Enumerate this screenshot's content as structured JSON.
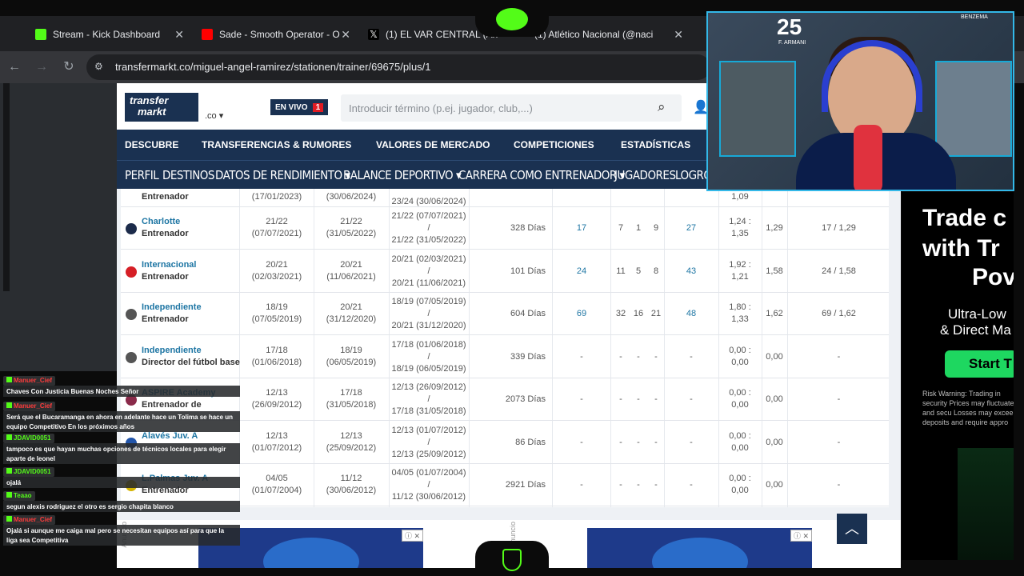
{
  "browser": {
    "tabs": [
      {
        "label": "Stream - Kick Dashboard",
        "color": "#53fc18"
      },
      {
        "label": "Sade - Smooth Operator - O",
        "color": "#ff0000"
      },
      {
        "label": "(1) EL VAR CENTRAL (An",
        "color": "#000000"
      },
      {
        "label": "(1) Atlético Nacional (@naci",
        "color": "#000000"
      }
    ],
    "url": "transfermarkt.co/miguel-angel-ramirez/stationen/trainer/69675/plus/1"
  },
  "site": {
    "logo_line1": "transfer",
    "logo_line2": "markt",
    "domain_suffix": ".co ▾",
    "live_label": "EN VIVO",
    "live_count": "1",
    "search_placeholder": "Introducir término (p.ej. jugador, club,...)"
  },
  "main_nav": [
    "DESCUBRE",
    "TRANSFERENCIAS & RUMORES",
    "VALORES DE MERCADO",
    "COMPETICIONES",
    "ESTADÍSTICAS"
  ],
  "sub_nav": [
    "PERFIL",
    "DESTINOS",
    "DATOS DE RENDIMIENTO ▾",
    "BALANCE DEPORTIVO ▾",
    "CARRERA COMO ENTRENADOR ▾",
    "JUGADORES",
    "LOGRO"
  ],
  "table": {
    "partial_row": {
      "role": "Entrenador",
      "from": "(17/01/2023)",
      "to": "(30/06/2024)",
      "period": "23/24 (30/06/2024)",
      "ppg": "1,09"
    },
    "rows": [
      {
        "club": "Charlotte",
        "role": "Entrenador",
        "from_season": "21/22",
        "from_date": "(07/07/2021)",
        "to_season": "21/22",
        "to_date": "(31/05/2022)",
        "period_start": "21/22 (07/07/2021)",
        "period_sep": "/",
        "period_end": "21/22 (31/05/2022)",
        "days": "328 Días",
        "matches": "17",
        "w": "7",
        "d": "1",
        "l": "9",
        "players": "27",
        "ppg_a": "1,24 :",
        "ppg_b": "1,35",
        "ppg": "1,29",
        "last": "17 / 1,29",
        "icon_color": "#1c2b4a"
      },
      {
        "club": "Internacional",
        "role": "Entrenador",
        "from_season": "20/21",
        "from_date": "(02/03/2021)",
        "to_season": "20/21",
        "to_date": "(11/06/2021)",
        "period_start": "20/21 (02/03/2021)",
        "period_sep": "/",
        "period_end": "20/21 (11/06/2021)",
        "days": "101 Días",
        "matches": "24",
        "w": "11",
        "d": "5",
        "l": "8",
        "players": "43",
        "ppg_a": "1,92 :",
        "ppg_b": "1,21",
        "ppg": "1,58",
        "last": "24 / 1,58",
        "icon_color": "#d61f26"
      },
      {
        "club": "Independiente",
        "role": "Entrenador",
        "from_season": "18/19",
        "from_date": "(07/05/2019)",
        "to_season": "20/21",
        "to_date": "(31/12/2020)",
        "period_start": "18/19 (07/05/2019)",
        "period_sep": "/",
        "period_end": "20/21 (31/12/2020)",
        "days": "604 Días",
        "matches": "69",
        "w": "32",
        "d": "16",
        "l": "21",
        "players": "48",
        "ppg_a": "1,80 :",
        "ppg_b": "1,33",
        "ppg": "1,62",
        "last": "69 / 1,62",
        "icon_color": "#555555"
      },
      {
        "club": "Independiente",
        "role": "Director del fútbol base",
        "from_season": "17/18",
        "from_date": "(01/06/2018)",
        "to_season": "18/19",
        "to_date": "(06/05/2019)",
        "period_start": "17/18 (01/06/2018)",
        "period_sep": "/",
        "period_end": "18/19 (06/05/2019)",
        "days": "339 Días",
        "matches": "-",
        "w": "-",
        "d": "-",
        "l": "-",
        "players": "-",
        "ppg_a": "0,00 :",
        "ppg_b": "0,00",
        "ppg": "0,00",
        "last": "-",
        "icon_color": "#555555"
      },
      {
        "club": "ASPIRE Academy",
        "role": "Entrenador de",
        "from_season": "12/13",
        "from_date": "(26/09/2012)",
        "to_season": "17/18",
        "to_date": "(31/05/2018)",
        "period_start": "12/13 (26/09/2012)",
        "period_sep": "/",
        "period_end": "17/18 (31/05/2018)",
        "days": "2073 Días",
        "matches": "-",
        "w": "-",
        "d": "-",
        "l": "-",
        "players": "-",
        "ppg_a": "0,00 :",
        "ppg_b": "0,00",
        "ppg": "0,00",
        "last": "-",
        "icon_color": "#8a2a4a"
      },
      {
        "club": "Alavés Juv. A",
        "role": "",
        "from_season": "12/13",
        "from_date": "(01/07/2012)",
        "to_season": "12/13",
        "to_date": "(25/09/2012)",
        "period_start": "12/13 (01/07/2012)",
        "period_sep": "/",
        "period_end": "12/13 (25/09/2012)",
        "days": "86 Días",
        "matches": "-",
        "w": "-",
        "d": "-",
        "l": "-",
        "players": "-",
        "ppg_a": "0,00 :",
        "ppg_b": "0,00",
        "ppg": "0,00",
        "last": "-",
        "icon_color": "#2255aa"
      },
      {
        "club": "L.Palmas Juv. A",
        "role": "Entrenador",
        "from_season": "04/05",
        "from_date": "(01/07/2004)",
        "to_season": "11/12",
        "to_date": "(30/06/2012)",
        "period_start": "04/05 (01/07/2004)",
        "period_sep": "/",
        "period_end": "11/12 (30/06/2012)",
        "days": "2921 Días",
        "matches": "-",
        "w": "-",
        "d": "-",
        "l": "-",
        "players": "-",
        "ppg_a": "0,00 :",
        "ppg_b": "0,00",
        "ppg": "0,00",
        "last": "-",
        "icon_color": "#d4b400"
      }
    ]
  },
  "ad_sidebar": {
    "line1": "Trade c",
    "line2": "with Tr",
    "line3": "Pov",
    "sub1": "Ultra-Low",
    "sub2": "& Direct Ma",
    "button": "Start T",
    "risk": "Risk Warning: Trading in security Prices may fluctuate and secu Losses may exceed deposits and require appro"
  },
  "ad_bottom_label": "Anuncio",
  "webcam": {
    "jersey_number": "25",
    "jersey_name": "F. ARMANI",
    "label": "BENZEMA"
  },
  "chat": [
    {
      "user": "Manuer_Cief",
      "user_color": "#ff3b3b",
      "text": "Chaves Con Justicia Buenas Noches Señor"
    },
    {
      "user": "Manuer_Cief",
      "user_color": "#ff3b3b",
      "text": "Será que el Bucaramanga en ahora en adelante hace un Tolima se hace un equipo Competitivo En los próximos años"
    },
    {
      "user": "JDAVID0051",
      "user_color": "#53fc18",
      "text": "tampoco es que hayan muchas opciones de técnicos locales para elegir aparte de leonel"
    },
    {
      "user": "JDAVID0051",
      "user_color": "#53fc18",
      "text": "ojalá"
    },
    {
      "user": "Teaao",
      "user_color": "#53fc18",
      "text": "segun alexis rodriguez el otro es sergio chapita blanco"
    },
    {
      "user": "Manuer_Cief",
      "user_color": "#ff3b3b",
      "text": "Ojalá si aunque me caiga mal pero se necesitan equipos así para que la liga sea Competitiva"
    }
  ]
}
